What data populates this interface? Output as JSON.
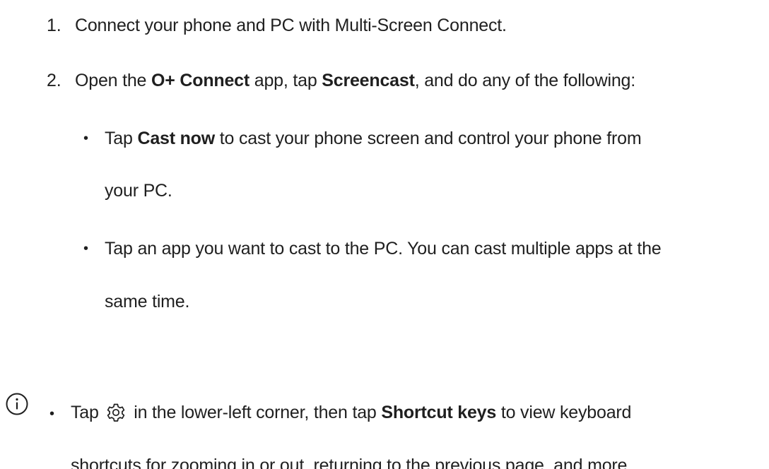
{
  "steps": [
    {
      "number": "1.",
      "text": "Connect your phone and PC with Multi-Screen Connect."
    },
    {
      "number": "2.",
      "pre": "Open the ",
      "app_name": "O+ Connect",
      "mid1": " app, tap ",
      "screencast": "Screencast",
      "post": ", and do any of the following:"
    }
  ],
  "sub_items": [
    {
      "pre": "Tap ",
      "bold": "Cast now",
      "line1_rest": " to cast your phone screen and control your phone from",
      "line2": "your PC."
    },
    {
      "line1": "Tap an app you want to cast to the PC. You can cast multiple apps at the",
      "line2": "same time."
    }
  ],
  "note": {
    "icon": "info-icon",
    "pre": "Tap ",
    "gear_icon": "gear-icon",
    "mid": " in the lower-left corner, then tap ",
    "bold": "Shortcut keys",
    "line1_rest": " to view keyboard",
    "line2": "shortcuts for zooming in or out, returning to the previous page, and more."
  },
  "bullet_char": "•"
}
